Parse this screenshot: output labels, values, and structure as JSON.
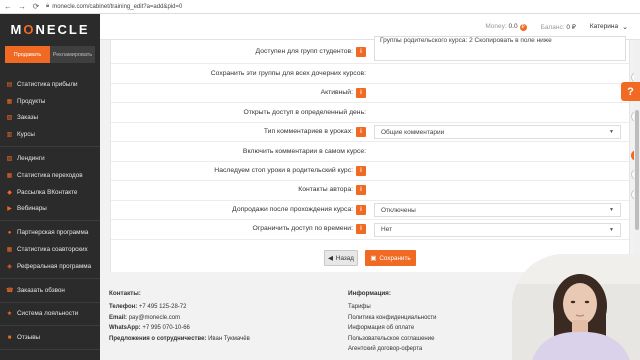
{
  "browser": {
    "url": "monecle.com/cabinet/training_edit?a=add&pid=0"
  },
  "sidebar": {
    "logo": "MONECLE",
    "modes": [
      {
        "label": "Продавать"
      },
      {
        "label": "Рекламировать"
      }
    ],
    "groups": [
      [
        {
          "label": "Статистика прибыли",
          "icon": "chart-icon"
        },
        {
          "label": "Продукты",
          "icon": "box-icon"
        },
        {
          "label": "Заказы",
          "icon": "cart-icon"
        },
        {
          "label": "Курсы",
          "icon": "book-icon"
        }
      ],
      [
        {
          "label": "Лендинги",
          "icon": "page-icon"
        },
        {
          "label": "Статистика переходов",
          "icon": "stats-icon"
        },
        {
          "label": "Рассылка ВКонтакте",
          "icon": "vk-icon"
        },
        {
          "label": "Вебинары",
          "icon": "video-icon"
        }
      ],
      [
        {
          "label": "Партнерская программа",
          "icon": "users-icon"
        },
        {
          "label": "Статистика соавторских",
          "icon": "stats-icon"
        },
        {
          "label": "Реферальная программа",
          "icon": "link-icon"
        }
      ],
      [
        {
          "label": "Заказать обзвон",
          "icon": "phone-icon"
        }
      ],
      [
        {
          "label": "Система лояльности",
          "icon": "star-icon"
        }
      ],
      [
        {
          "label": "Отзывы",
          "icon": "comment-icon"
        }
      ]
    ]
  },
  "topbar": {
    "money_label": "Money:",
    "money_value": "0.0",
    "balance_label": "Баланс:",
    "balance_value": "0 ₽",
    "user_name": "Катерина"
  },
  "form": {
    "groups_text_label": "Доступен для групп студентов:",
    "groups_text_value": "Группы родительского курса: 2 Скопировать в поле ниже",
    "rows": [
      {
        "label": "Сохранить эти группы для всех дочерних курсов:",
        "info": false,
        "type": "toggle",
        "on": false
      },
      {
        "label": "Активный:",
        "info": true,
        "type": "toggle",
        "on": false
      },
      {
        "label": "Открыть доступ в определенный день:",
        "info": false,
        "type": "toggle",
        "on": false
      },
      {
        "label": "Тип комментариев в уроках:",
        "info": true,
        "type": "select",
        "value": "Общие комментарии"
      },
      {
        "label": "Включить комментарии в самом курсе:",
        "info": false,
        "type": "toggle",
        "on": true
      },
      {
        "label": "Наследуем стоп уроки в родительский курс:",
        "info": true,
        "type": "toggle",
        "on": false
      },
      {
        "label": "Контакты автора:",
        "info": true,
        "type": "toggle",
        "on": false
      },
      {
        "label": "Допродажи после прохождения курса:",
        "info": true,
        "type": "select",
        "value": "Отключены"
      },
      {
        "label": "Ограничить доступ по времени:",
        "info": true,
        "type": "select",
        "value": "Нет"
      }
    ],
    "info_glyph": "i",
    "back_label": "Назад",
    "save_label": "Сохранить"
  },
  "help_glyph": "?",
  "footer": {
    "contacts_title": "Контакты:",
    "phone_label": "Телефон:",
    "phone_value": "+7 495 125-28-72",
    "email_label": "Email:",
    "email_value": "pay@monecle.com",
    "whatsapp_label": "WhatsApp:",
    "whatsapp_value": "+7 995 070-10-66",
    "partner_label": "Предложения о сотрудничестве:",
    "partner_value": "Иван Тукмачёв",
    "info_title": "Информация:",
    "info_links": [
      "Тарифы",
      "Политика конфиденциальности",
      "Информация об оплате",
      "Пользовательское соглашение",
      "Агентский договор-оферта"
    ]
  },
  "colors": {
    "accent": "#f06a24",
    "sidebar_bg": "#2b2b2b"
  }
}
